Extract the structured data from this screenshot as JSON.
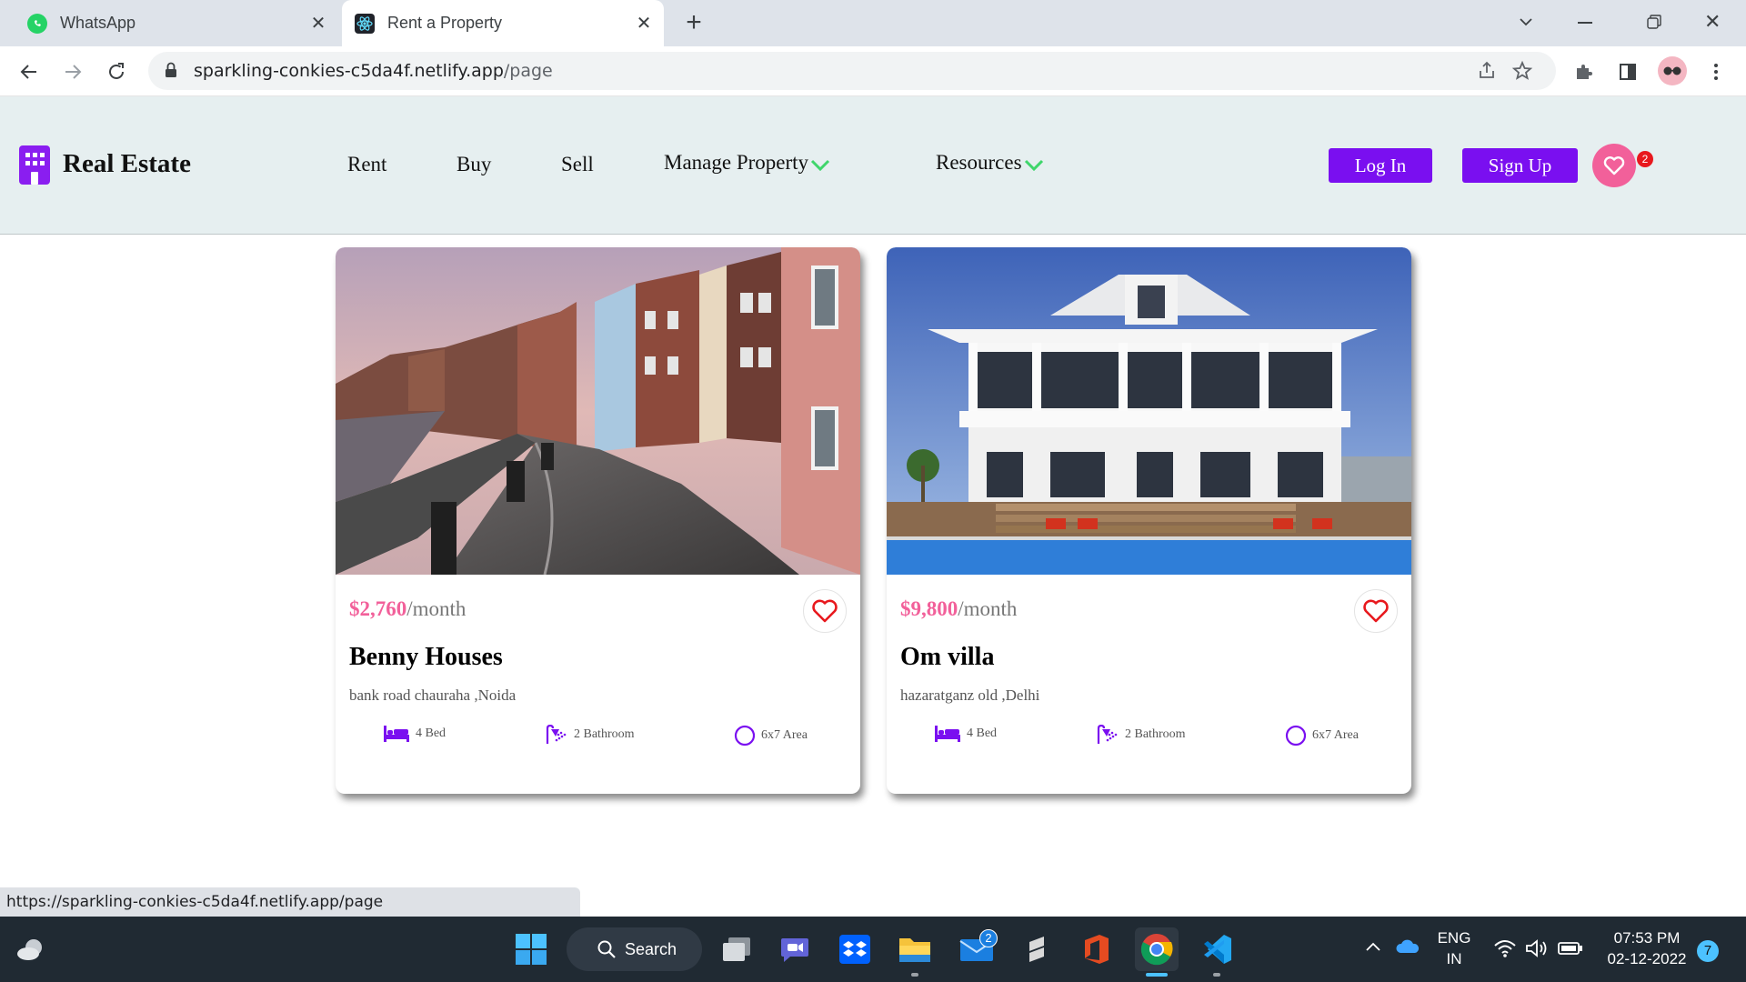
{
  "browser": {
    "tabs": [
      {
        "title": "WhatsApp",
        "icon": "whatsapp-icon",
        "active": false
      },
      {
        "title": "Rent a Property",
        "icon": "react-icon",
        "active": true
      }
    ],
    "url_host": "sparkling-conkies-c5da4f.netlify.app",
    "url_path": "/page",
    "status_url": "https://sparkling-conkies-c5da4f.netlify.app/page"
  },
  "site": {
    "brand": "Real Estate",
    "nav": [
      "Rent",
      "Buy",
      "Sell",
      "Manage Property",
      "Resources"
    ],
    "login_label": "Log In",
    "signup_label": "Sign Up",
    "favorites_count": "2",
    "colors": {
      "accent": "#7a0ff0",
      "pink": "#f2609a",
      "header_bg": "#e6eff0",
      "green_chevron": "#3fd66b"
    }
  },
  "properties": [
    {
      "price": "$2,760",
      "per": "/month",
      "name": "Benny Houses",
      "location": "bank road chauraha ,Noida",
      "beds": "4 Bed",
      "baths": "2 Bathroom",
      "area": "6x7 Area"
    },
    {
      "price": "$9,800",
      "per": "/month",
      "name": "Om villa",
      "location": "hazaratganz old ,Delhi",
      "beds": "4 Bed",
      "baths": "2 Bathroom",
      "area": "6x7 Area"
    }
  ],
  "taskbar": {
    "search_label": "Search",
    "mail_badge": "2",
    "lang_top": "ENG",
    "lang_bottom": "IN",
    "time": "07:53 PM",
    "date": "02-12-2022",
    "notif_count": "7"
  }
}
